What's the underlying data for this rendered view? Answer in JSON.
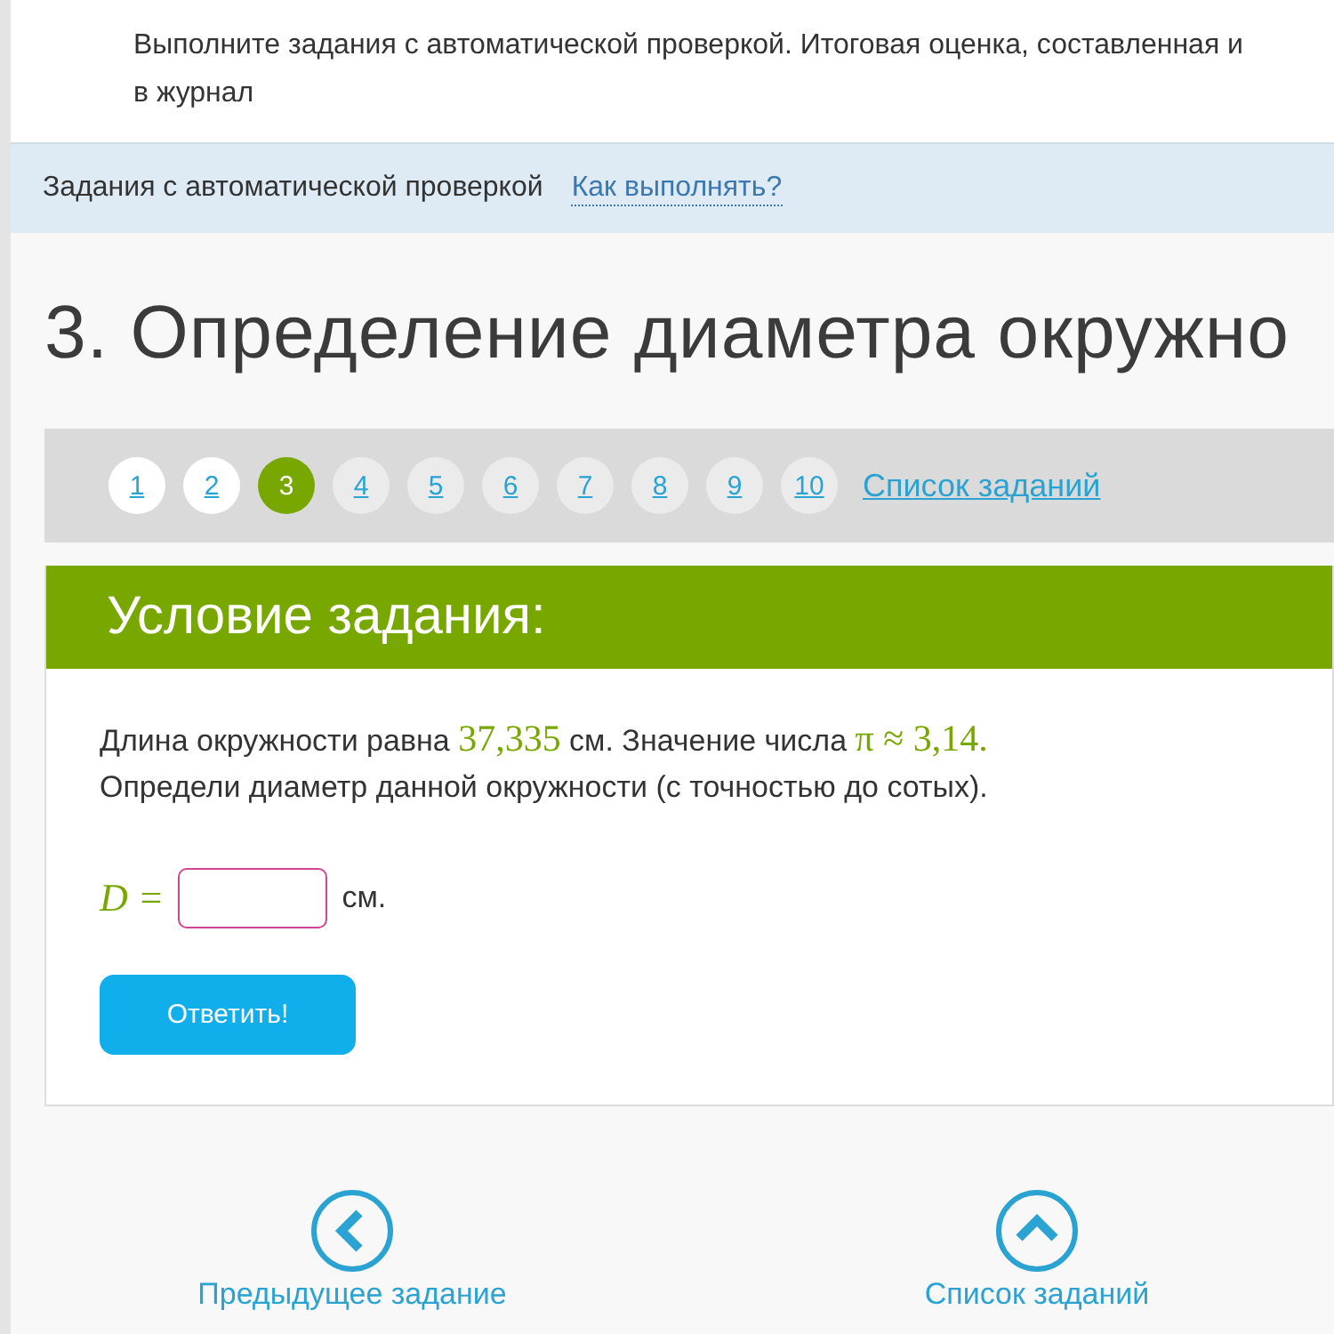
{
  "intro": {
    "text": "Выполните задания с автоматической проверкой. Итоговая оценка, составленная и",
    "text2": "в журнал"
  },
  "breadcrumb": {
    "label": "Задания с автоматической проверкой",
    "link": "Как выполнять?"
  },
  "title": "3. Определение диаметра окружно",
  "pager": {
    "items": [
      {
        "label": "1",
        "selected": false,
        "visited": true
      },
      {
        "label": "2",
        "selected": false,
        "visited": true
      },
      {
        "label": "3",
        "selected": true
      },
      {
        "label": "4",
        "selected": false,
        "visited": false
      },
      {
        "label": "5",
        "selected": false,
        "visited": false
      },
      {
        "label": "6",
        "selected": false,
        "visited": false
      },
      {
        "label": "7",
        "selected": false,
        "visited": false
      },
      {
        "label": "8",
        "selected": false,
        "visited": false
      },
      {
        "label": "9",
        "selected": false,
        "visited": false
      },
      {
        "label": "10",
        "selected": false,
        "visited": false
      }
    ],
    "list_link": "Список заданий"
  },
  "task": {
    "header": "Условие задания:",
    "statement": [
      {
        "kind": "text",
        "text": "Длина окружности равна "
      },
      {
        "kind": "math",
        "text": "37,335"
      },
      {
        "kind": "text",
        "text": " см. Значение числа "
      },
      {
        "kind": "math",
        "text": "π ≈ 3,14."
      }
    ],
    "question": "Определи диаметр данной окружности (с точностью до сотых).",
    "answer_label": "D =",
    "unit": "см.",
    "submit": "Ответить!"
  },
  "footer_nav": [
    {
      "kind": "prev",
      "label": "Предыдущее задание"
    },
    {
      "kind": "up",
      "label": "Список заданий"
    }
  ]
}
